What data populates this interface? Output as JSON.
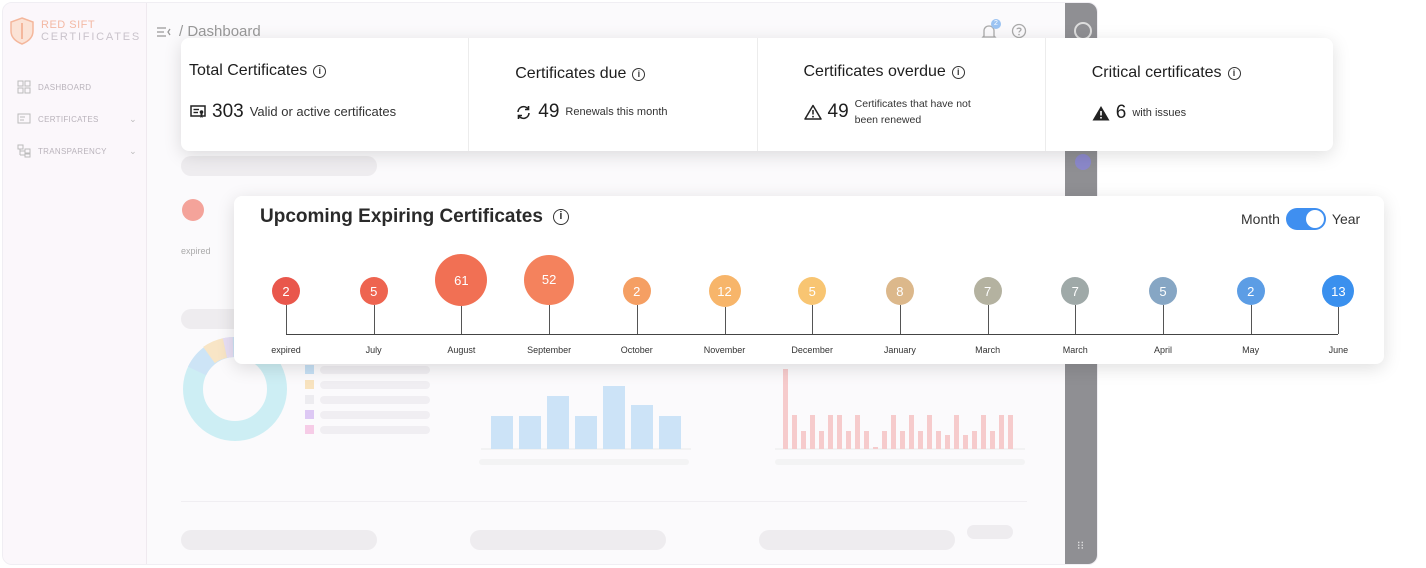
{
  "app": {
    "logo_line1": "RED SIFT",
    "logo_line2": "CERTIFICATES",
    "breadcrumb": "/ Dashboard"
  },
  "sidebar": {
    "items": [
      {
        "label": "DASHBOARD",
        "icon": "dashboard-icon"
      },
      {
        "label": "CERTIFICATES",
        "icon": "certificate-icon"
      },
      {
        "label": "TRANSPARENCY",
        "icon": "transparency-icon"
      }
    ]
  },
  "header": {
    "notification_count": "2"
  },
  "stats": {
    "total": {
      "title": "Total Certificates",
      "value": "303",
      "desc": "Valid or active certificates"
    },
    "due": {
      "title": "Certificates due",
      "value": "49",
      "desc": "Renewals this month"
    },
    "overdue": {
      "title": "Certificates overdue",
      "value": "49",
      "desc_line1": "Certificates that have not",
      "desc_line2": "been renewed"
    },
    "critical": {
      "title": "Critical certificates",
      "value": "6",
      "desc": "with issues"
    }
  },
  "background": {
    "expired_label": "expired"
  },
  "timeline": {
    "title": "Upcoming Expiring Certificates",
    "toggle_left": "Month",
    "toggle_right": "Year",
    "items": [
      {
        "label": "expired",
        "value": 2,
        "color": "#e9574c"
      },
      {
        "label": "July",
        "value": 5,
        "color": "#ee6450"
      },
      {
        "label": "August",
        "value": 61,
        "color": "#f17054"
      },
      {
        "label": "September",
        "value": 52,
        "color": "#f4825d"
      },
      {
        "label": "October",
        "value": 2,
        "color": "#f59f63"
      },
      {
        "label": "November",
        "value": 12,
        "color": "#f7b56a"
      },
      {
        "label": "December",
        "value": 5,
        "color": "#f8c572"
      },
      {
        "label": "January",
        "value": 8,
        "color": "#dcb88b"
      },
      {
        "label": "March",
        "value": 7,
        "color": "#b4b2a0"
      },
      {
        "label": "March",
        "value": 7,
        "color": "#9fa9a8"
      },
      {
        "label": "April",
        "value": 5,
        "color": "#86a6c4"
      },
      {
        "label": "May",
        "value": 2,
        "color": "#5c9de5"
      },
      {
        "label": "June",
        "value": 13,
        "color": "#3a90ee"
      }
    ]
  }
}
